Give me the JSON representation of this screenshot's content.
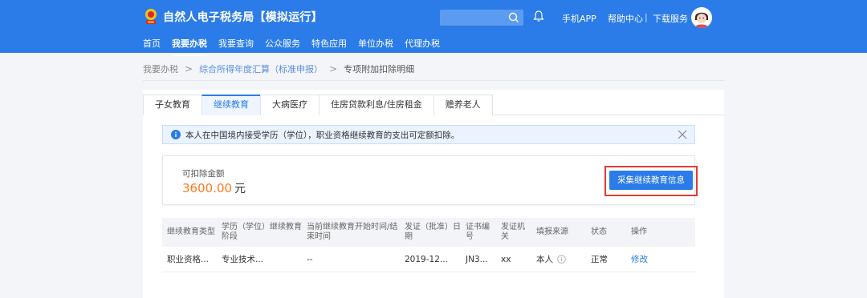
{
  "header": {
    "title": "自然人电子税务局【模拟运行】",
    "search_placeholder": "",
    "links": {
      "mobile_app": "手机APP",
      "help": "帮助中心",
      "separator": "|",
      "download": "下载服务"
    },
    "menu": [
      "首页",
      "我要办税",
      "我要查询",
      "公众服务",
      "特色应用",
      "单位办税",
      "代理办税"
    ],
    "active_menu_index": 1,
    "brand_color": "#2b7ce9"
  },
  "breadcrumb": {
    "items": [
      "我要办税",
      "综合所得年度汇算（标准申报）",
      "专项附加扣除明细"
    ],
    "separator": ">"
  },
  "tabs": [
    "子女教育",
    "继续教育",
    "大病医疗",
    "住房贷款利息/住房租金",
    "赡养老人"
  ],
  "active_tab_index": 1,
  "notice": {
    "text": "本人在中国境内接受学历（学位），职业资格继续教育的支出可定额扣除。",
    "icon": "info-icon",
    "close_icon": "close-icon"
  },
  "amount": {
    "label": "可扣除金额",
    "value": "3600.00",
    "unit": "元",
    "button": "采集继续教育信息",
    "value_color": "#ff7a1a",
    "highlight_color": "#e53935"
  },
  "table": {
    "headers": [
      "继续教育类型",
      "学历（学位）继续教育阶段",
      "当前继续教育开始时间/结束时间",
      "发证（批准）日期",
      "证书编号",
      "发证机关",
      "填报来源",
      "状态",
      "操作"
    ],
    "rows": [
      [
        "职业资格...",
        "专业技术...",
        "--",
        "2019-12...",
        "JN3...",
        "xx",
        "本人",
        "正常",
        "修改"
      ]
    ]
  }
}
